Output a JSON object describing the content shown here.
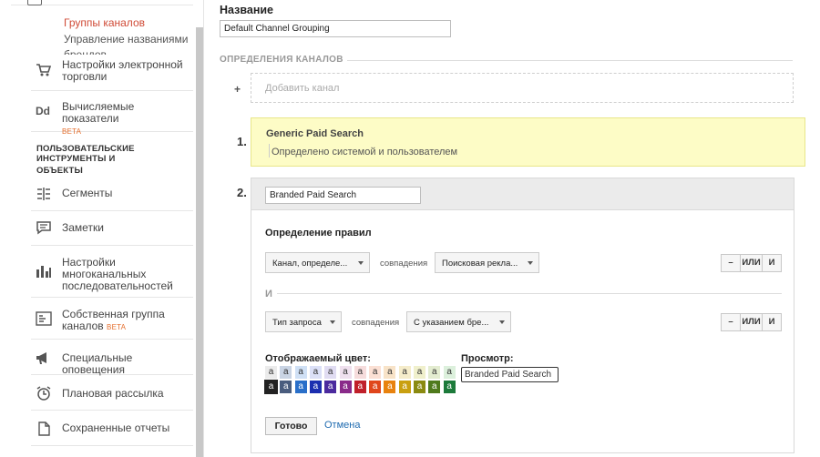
{
  "sidebar": {
    "subitems": [
      {
        "label": "Группы каналов",
        "active": true
      },
      {
        "label": "Управление названиями",
        "active": false
      },
      {
        "label": "брендов",
        "active": false
      }
    ],
    "items_top": [
      {
        "label_lines": [
          "Настройки электронной",
          "торговли"
        ],
        "icon": "cart-icon"
      },
      {
        "label_lines": [
          "Вычисляемые показатели"
        ],
        "beta": "BETA",
        "icon": "dd-icon",
        "icon_text": "Dd"
      }
    ],
    "section_title_lines": [
      "ПОЛЬЗОВАТЕЛЬСКИЕ ИНСТРУМЕНТЫ И",
      "ОБЪЕКТЫ"
    ],
    "items_bottom": [
      {
        "label_lines": [
          "Сегменты"
        ],
        "icon": "segments-icon"
      },
      {
        "label_lines": [
          "Заметки"
        ],
        "icon": "notes-icon"
      },
      {
        "label_lines": [
          "Настройки",
          "многоканальных",
          "последовательностей"
        ],
        "icon": "bar-chart-icon"
      },
      {
        "label_lines": [
          "Собственная группа",
          "каналов"
        ],
        "beta": "BETA",
        "icon": "channel-group-icon"
      },
      {
        "label_lines": [
          "Специальные оповещения"
        ],
        "icon": "megaphone-icon"
      },
      {
        "label_lines": [
          "Плановая рассылка"
        ],
        "icon": "alarm-clock-icon"
      },
      {
        "label_lines": [
          "Сохраненные отчеты"
        ],
        "icon": "document-icon"
      }
    ]
  },
  "form": {
    "name_label": "Название",
    "name_value": "Default Channel Grouping",
    "definitions_header": "ОПРЕДЕЛЕНИЯ КАНАЛОВ",
    "add_plus": "+",
    "add_channel_label": "Добавить канал"
  },
  "channels": [
    {
      "number": "1.",
      "name": "Generic Paid Search",
      "description": "Определено системой и пользователем"
    },
    {
      "number": "2.",
      "name_value": "Branded Paid Search",
      "rules_title": "Определение правил",
      "rules": [
        {
          "dimension": "Канал, определе...",
          "match": "совпадения",
          "value": "Поисковая рекла...",
          "minus": "–",
          "or": "ИЛИ",
          "and": "И"
        },
        {
          "dimension": "Тип запроса",
          "match": "совпадения",
          "value": "С указанием бре...",
          "minus": "–",
          "or": "ИЛИ",
          "and": "И"
        }
      ],
      "and_label": "И",
      "color_title": "Отображаемый цвет:",
      "preview_title": "Просмотр:",
      "preview_text": "Branded Paid Search",
      "swatch_letter": "a",
      "swatches_light": [
        {
          "bg": "#ebebeb",
          "fg": "#333333"
        },
        {
          "bg": "#c9d4e4",
          "fg": "#333333"
        },
        {
          "bg": "#cfe0f5",
          "fg": "#333333"
        },
        {
          "bg": "#dbe0f7",
          "fg": "#333333"
        },
        {
          "bg": "#e0dcf2",
          "fg": "#333333"
        },
        {
          "bg": "#efe0ee",
          "fg": "#333333"
        },
        {
          "bg": "#f6dcdc",
          "fg": "#333333"
        },
        {
          "bg": "#fbe0d4",
          "fg": "#333333"
        },
        {
          "bg": "#f8e3c8",
          "fg": "#333333"
        },
        {
          "bg": "#f5ecca",
          "fg": "#333333"
        },
        {
          "bg": "#f0f0cc",
          "fg": "#333333"
        },
        {
          "bg": "#e3ecd0",
          "fg": "#333333"
        },
        {
          "bg": "#dcf0dc",
          "fg": "#333333"
        }
      ],
      "swatches_dark": [
        {
          "bg": "#222222",
          "fg": "#ffffff"
        },
        {
          "bg": "#4a5d7e",
          "fg": "#ffffff"
        },
        {
          "bg": "#2a6fc9",
          "fg": "#ffffff"
        },
        {
          "bg": "#1c2fb0",
          "fg": "#ffffff"
        },
        {
          "bg": "#4b2a9e",
          "fg": "#ffffff"
        },
        {
          "bg": "#8a2a8a",
          "fg": "#ffffff"
        },
        {
          "bg": "#c0202a",
          "fg": "#ffffff"
        },
        {
          "bg": "#e0461c",
          "fg": "#ffffff"
        },
        {
          "bg": "#e8820e",
          "fg": "#ffffff"
        },
        {
          "bg": "#c9a010",
          "fg": "#ffffff"
        },
        {
          "bg": "#8a8a10",
          "fg": "#ffffff"
        },
        {
          "bg": "#4f7a1c",
          "fg": "#ffffff"
        },
        {
          "bg": "#1c7a3a",
          "fg": "#ffffff"
        }
      ],
      "done_label": "Готово",
      "cancel_label": "Отмена"
    }
  ]
}
